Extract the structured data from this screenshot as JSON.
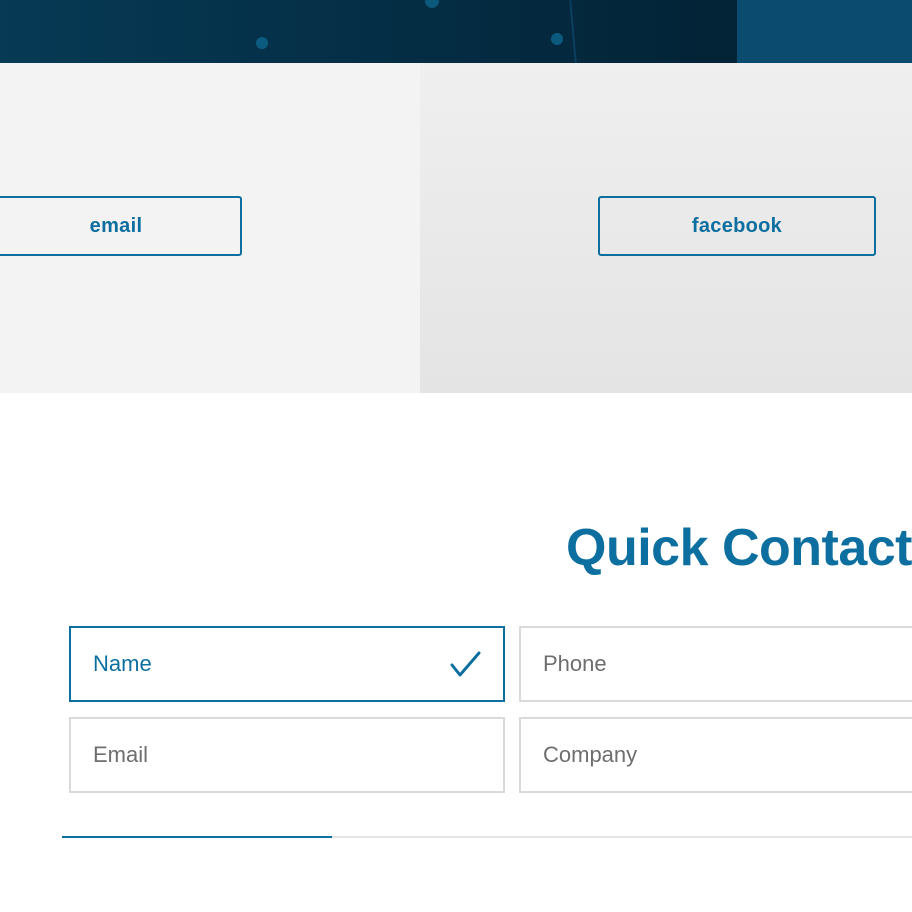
{
  "social": {
    "email_label": "email",
    "facebook_label": "facebook"
  },
  "contact": {
    "title": "Quick Contact",
    "fields": {
      "name_placeholder": "Name",
      "phone_placeholder": "Phone",
      "email_placeholder": "Email",
      "company_placeholder": "Company"
    },
    "progress_fraction": 0.318
  },
  "colors": {
    "accent": "#0d6fa0",
    "banner_dark": "#042a40",
    "banner_block": "#0b4b6f",
    "panel_left": "#f3f3f3",
    "panel_right": "#e9e9e9",
    "field_border": "#dadada"
  },
  "icons": {
    "valid": "checkmark-icon"
  }
}
